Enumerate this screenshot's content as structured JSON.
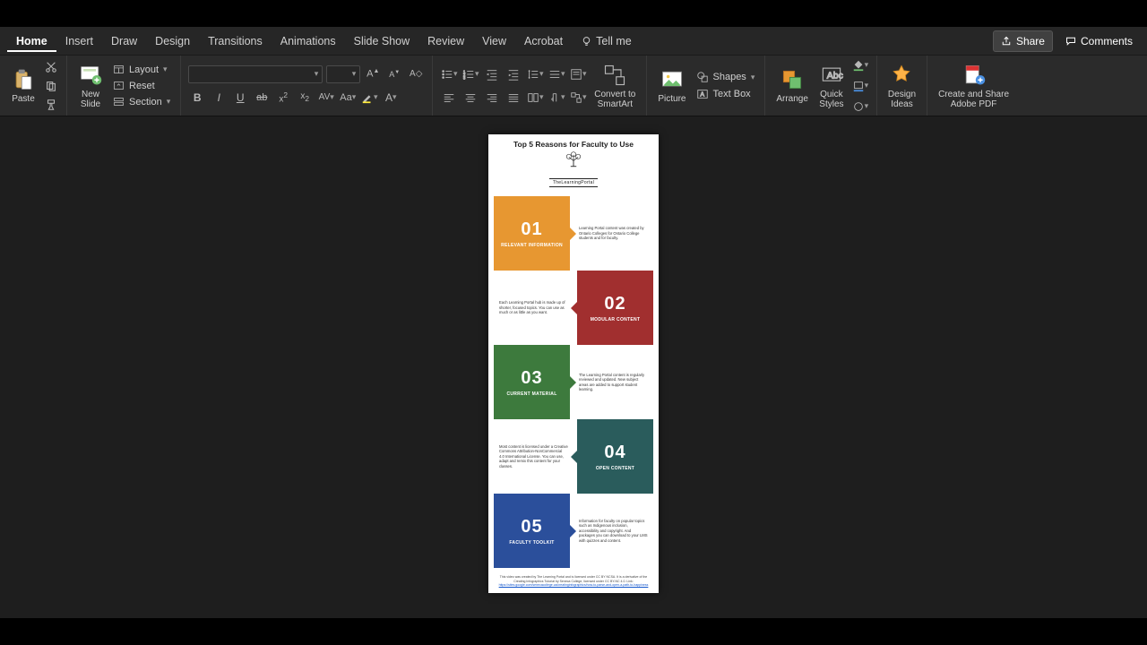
{
  "tabs": {
    "items": [
      "Home",
      "Insert",
      "Draw",
      "Design",
      "Transitions",
      "Animations",
      "Slide Show",
      "Review",
      "View",
      "Acrobat"
    ],
    "tellme": "Tell me",
    "share": "Share",
    "comments": "Comments"
  },
  "ribbon": {
    "paste": "Paste",
    "new_slide": "New\nSlide",
    "layout": "Layout",
    "reset": "Reset",
    "section": "Section",
    "convert_smartart": "Convert to\nSmartArt",
    "picture": "Picture",
    "shapes": "Shapes",
    "textbox": "Text Box",
    "arrange": "Arrange",
    "quick_styles": "Quick\nStyles",
    "design_ideas": "Design\nIdeas",
    "adobe_pdf": "Create and Share\nAdobe PDF"
  },
  "slide": {
    "title": "Top 5 Reasons for Faculty to Use",
    "logo_text": "TheLearningPortal",
    "reasons": [
      {
        "num": "01",
        "heading": "RELEVANT INFORMATION",
        "text": "Learning Portal content was created by Ontario Colleges for Ontario College students and for faculty."
      },
      {
        "num": "02",
        "heading": "MODULAR CONTENT",
        "text": "Each Learning Portal hub is made up of shorter, focused topics. You can use as much or as little as you want."
      },
      {
        "num": "03",
        "heading": "CURRENT MATERIAL",
        "text": "The Learning Portal content is regularly reviewed and updated. New subject areas are added to support student learning."
      },
      {
        "num": "04",
        "heading": "OPEN CONTENT",
        "text": "Most content is licensed under a Creative Commons Attribution-NonCommercial 4.0 International License. You can use, adapt and remix this content for your classes."
      },
      {
        "num": "05",
        "heading": "FACULTY TOOLKIT",
        "text": "Information for faculty on popular topics such as Indigenous inclusion, accessibility and copyright. And packages you can download to your LMS with quizzes and content."
      }
    ],
    "credit_line1": "This video was created by The Learning Portal and is licensed under CC BY NCSA. It is a derivative of the Creating Infographics Tutorial by Seneca College, licensed under CC BY-NC 4.0. Link:",
    "credit_link": "https://sites.google.com/senecacollege.ca/creatinginfographics/how-to-parse-and-open-a-path-to-happiness"
  }
}
